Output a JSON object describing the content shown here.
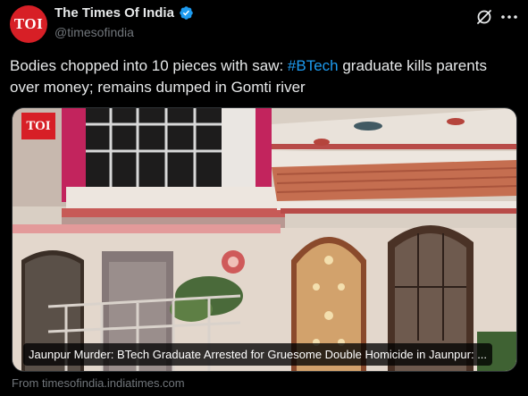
{
  "account": {
    "name": "The Times Of India",
    "handle": "@timesofindia",
    "avatar_text": "TOI",
    "verified": true
  },
  "header_actions": {
    "grok_icon": "grok-slash-icon",
    "more_icon": "more-dots-icon"
  },
  "tweet": {
    "text_before": "Bodies chopped into 10 pieces with saw: ",
    "hashtag": "#BTech",
    "text_after": " graduate kills parents over money; remains dumped in Gomti river"
  },
  "media": {
    "logo_text": "TOI",
    "caption": "Jaunpur Murder: BTech Graduate Arrested for Gruesome Double Homicide in Jaunpur: ..."
  },
  "link_source": "From timesofindia.indiatimes.com",
  "colors": {
    "background": "#000000",
    "hashtag": "#1d9bf0",
    "verified": "#1d9bf0",
    "brand_red": "#d71f26",
    "secondary_text": "#71767b"
  }
}
